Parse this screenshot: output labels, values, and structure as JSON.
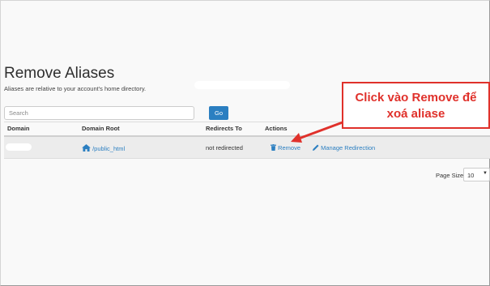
{
  "page": {
    "title": "Remove Aliases",
    "subtitle": "Aliases are relative to your account's home directory."
  },
  "search": {
    "placeholder": "Search",
    "go_label": "Go"
  },
  "table": {
    "headers": [
      "Domain",
      "Domain Root",
      "Redirects To",
      "Actions"
    ],
    "rows": [
      {
        "domain": "",
        "domain_root": "/public_html",
        "redirects_to": "not redirected",
        "remove_label": "Remove",
        "manage_label": "Manage Redirection"
      }
    ]
  },
  "pagination": {
    "page_size_label": "Page Size",
    "page_size_value": "10"
  },
  "annotation": {
    "line1": "Click vào Remove để",
    "line2": "xoá aliase"
  },
  "colors": {
    "link": "#2b7fc1",
    "button": "#2b7fc1",
    "annotation": "#e0312b"
  },
  "icons": {
    "domain_root": "house-icon",
    "remove": "trash-icon",
    "manage": "pencil-icon",
    "callout_arrow": "arrow-icon"
  }
}
